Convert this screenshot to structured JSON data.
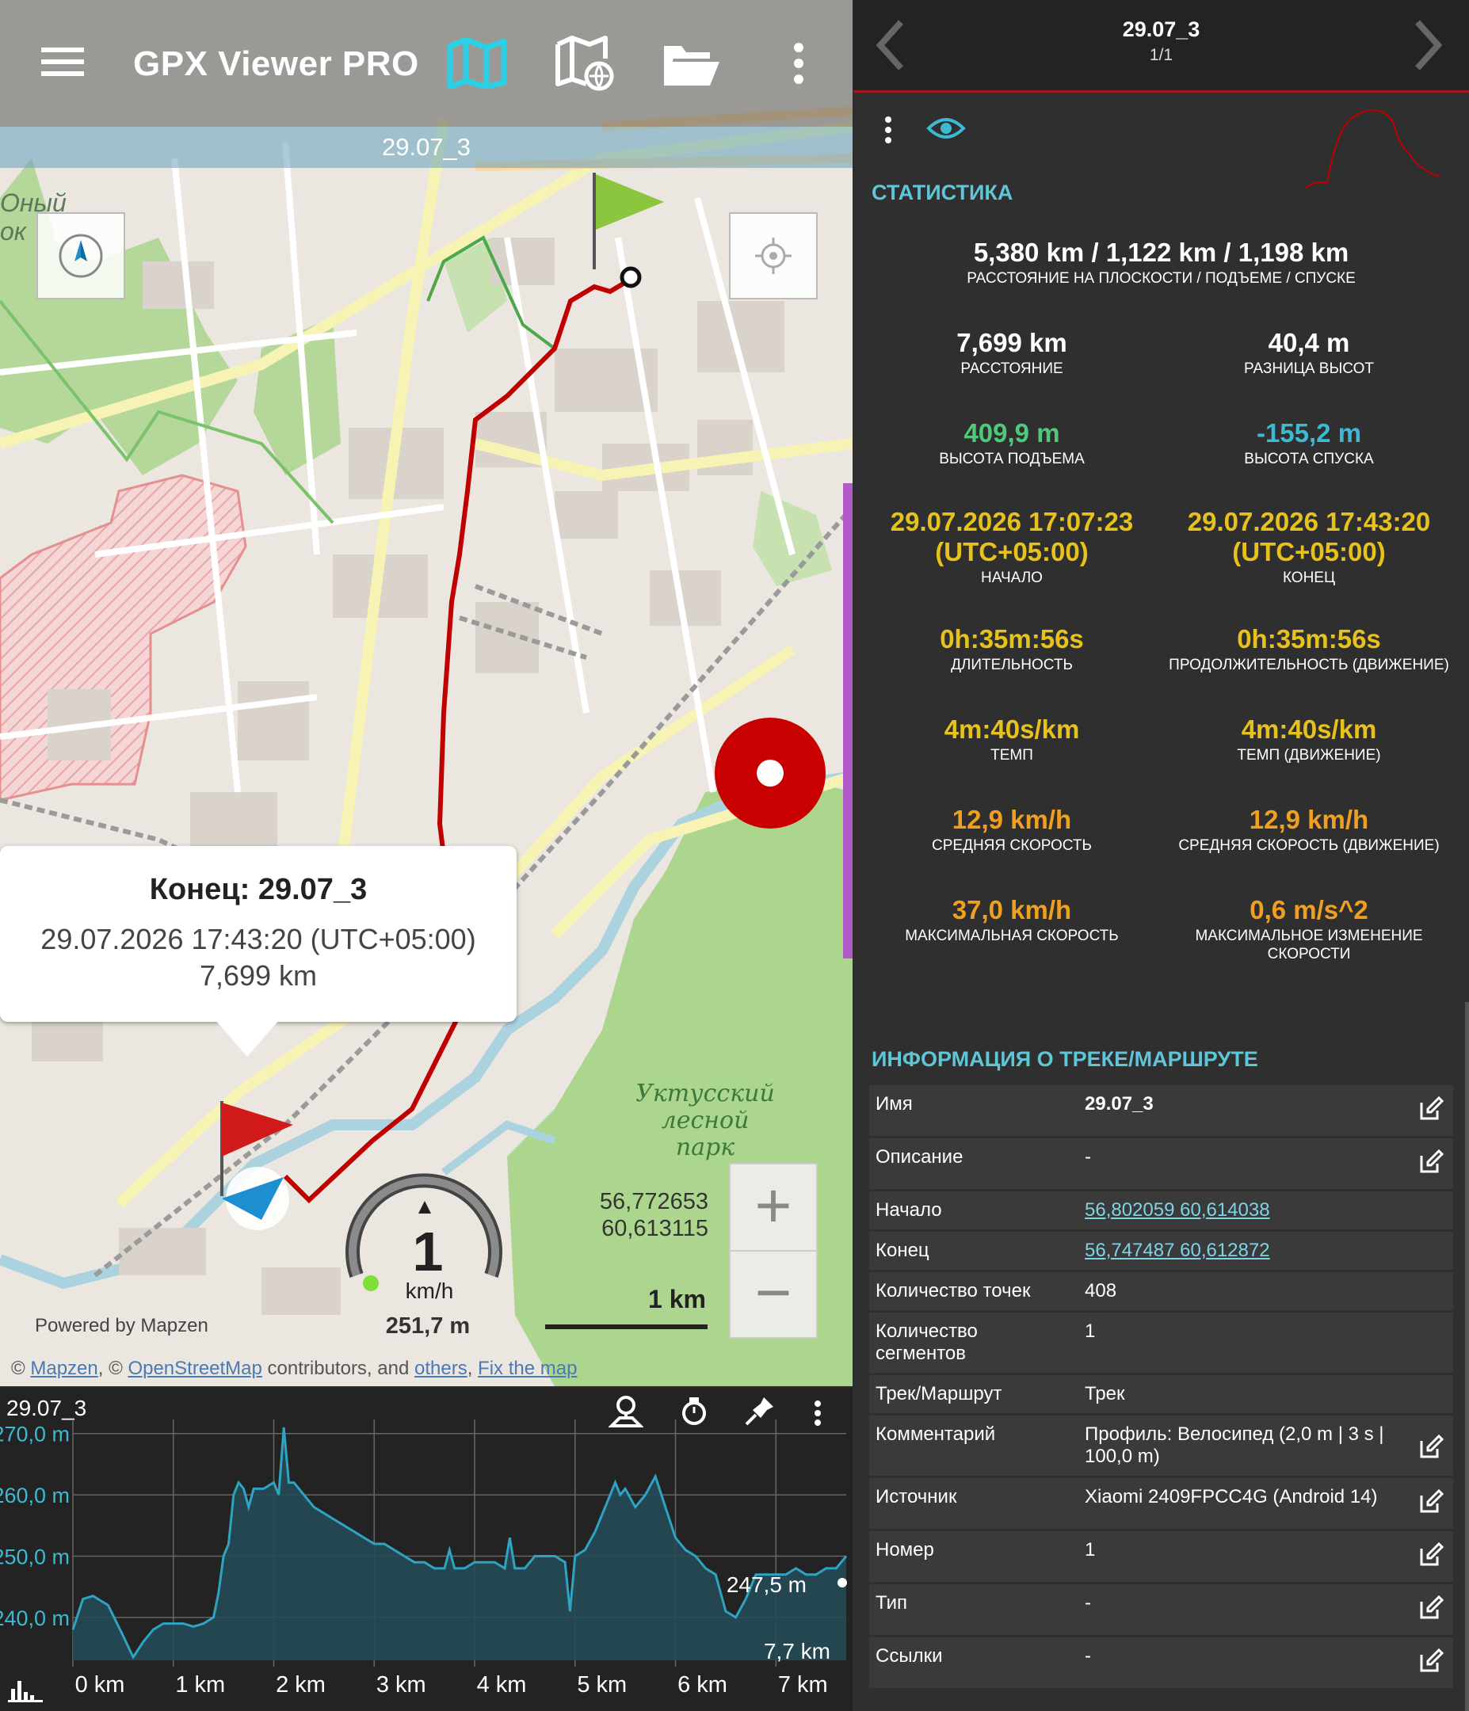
{
  "app": {
    "title": "GPX Viewer PRO"
  },
  "map": {
    "track_strip": "29.07_3",
    "popup": {
      "title": "Конец: 29.07_3",
      "time": "29.07.2026 17:43:20 (UTC+05:00)",
      "distance": "7,699 km"
    },
    "coords": {
      "lat": "56,772653",
      "lon": "60,613115"
    },
    "scale_label": "1 km",
    "speed": {
      "value": "1",
      "unit": "km/h",
      "distance": "251,7 m"
    },
    "park_label_1": "Уктусский",
    "park_label_2": "лесной парк",
    "district_fragment_1": "Оный",
    "district_fragment_2": "ок",
    "powered_by": "Powered by Mapzen",
    "attribution": {
      "prefix": "© ",
      "mapzen": "Mapzen",
      "sep": ", © ",
      "osm": "OpenStreetMap",
      "mid": " contributors, and ",
      "others": "others",
      "comma": ", ",
      "fix": "Fix the map"
    },
    "zoom_in": "+",
    "zoom_out": "−"
  },
  "elevation": {
    "title": "29.07_3",
    "current_value": "247,5 m",
    "current_distance": "7,7 km",
    "chart_data": {
      "type": "area",
      "xlabel": "",
      "ylabel": "",
      "x_ticks": [
        "0 km",
        "1 km",
        "2 km",
        "3 km",
        "4 km",
        "5 km",
        "6 km",
        "7 km"
      ],
      "y_ticks": [
        "270,0 m",
        "260,0 m",
        "250,0 m",
        "240,0 m"
      ],
      "ylim": [
        233,
        271
      ],
      "xlim": [
        0,
        7.7
      ],
      "x": [
        0,
        0.1,
        0.2,
        0.35,
        0.5,
        0.6,
        0.7,
        0.8,
        0.9,
        1.0,
        1.1,
        1.2,
        1.3,
        1.4,
        1.45,
        1.5,
        1.55,
        1.6,
        1.65,
        1.7,
        1.75,
        1.8,
        1.9,
        2.0,
        2.05,
        2.1,
        2.15,
        2.2,
        2.3,
        2.4,
        2.5,
        2.6,
        2.7,
        2.8,
        2.9,
        3.0,
        3.1,
        3.2,
        3.3,
        3.4,
        3.5,
        3.6,
        3.7,
        3.75,
        3.8,
        3.9,
        4.0,
        4.1,
        4.2,
        4.3,
        4.35,
        4.4,
        4.5,
        4.6,
        4.7,
        4.8,
        4.9,
        4.95,
        5.0,
        5.1,
        5.2,
        5.3,
        5.4,
        5.45,
        5.5,
        5.6,
        5.7,
        5.8,
        5.9,
        6.0,
        6.1,
        6.2,
        6.3,
        6.4,
        6.5,
        6.6,
        6.7,
        6.8,
        6.9,
        7.0,
        7.1,
        7.2,
        7.3,
        7.4,
        7.5,
        7.6,
        7.7
      ],
      "values": [
        238,
        243,
        243.5,
        242,
        237,
        233.5,
        236,
        238,
        239,
        239,
        239,
        238.5,
        239,
        240,
        244,
        250,
        252,
        260,
        262,
        261,
        258,
        261,
        261,
        262,
        260,
        271,
        262,
        262,
        260,
        258,
        257,
        256,
        255,
        254,
        253,
        252,
        252,
        251,
        250,
        249,
        249,
        248,
        248,
        251,
        248,
        248,
        249,
        249,
        249,
        248,
        253,
        248,
        248,
        250,
        250,
        250,
        249,
        241,
        250,
        251,
        254,
        258,
        262,
        260,
        261,
        258,
        260,
        263,
        258,
        253,
        251,
        250,
        248,
        247,
        241,
        240,
        243,
        247,
        247,
        247,
        247,
        248,
        247,
        247,
        248,
        248,
        250
      ]
    }
  },
  "right": {
    "title": "29.07_3",
    "subtitle": "1/1",
    "stats_header": "СТАТИСТИКА",
    "summary": {
      "value": "5,380 km / 1,122 km / 1,198 km",
      "label": "РАССТОЯНИЕ НА ПЛОСКОСТИ / ПОДЪЕМЕ / СПУСКЕ"
    },
    "stats": [
      {
        "value": "7,699 km",
        "label": "РАССТОЯНИЕ",
        "color": "#ffffff"
      },
      {
        "value": "40,4 m",
        "label": "РАЗНИЦА ВЫСОТ",
        "color": "#ffffff"
      },
      {
        "value": "409,9 m",
        "label": "ВЫСОТА ПОДЪЕМА",
        "color": "#4fc97a"
      },
      {
        "value": "-155,2 m",
        "label": "ВЫСОТА СПУСКА",
        "color": "#3bbad2"
      },
      {
        "value": "29.07.2026 17:07:23 (UTC+05:00)",
        "label": "НАЧАЛО",
        "color": "#e8c21c"
      },
      {
        "value": "29.07.2026 17:43:20 (UTC+05:00)",
        "label": "КОНЕЦ",
        "color": "#e8c21c"
      },
      {
        "value": "0h:35m:56s",
        "label": "ДЛИТЕЛЬНОСТЬ",
        "color": "#e8c21c"
      },
      {
        "value": "0h:35m:56s",
        "label": "ПРОДОЛЖИТЕЛЬНОСТЬ (ДВИЖЕНИЕ)",
        "color": "#e8c21c"
      },
      {
        "value": "4m:40s/km",
        "label": "ТЕМП",
        "color": "#e8c21c"
      },
      {
        "value": "4m:40s/km",
        "label": "ТЕМП (ДВИЖЕНИЕ)",
        "color": "#e8c21c"
      },
      {
        "value": "12,9 km/h",
        "label": "СРЕДНЯЯ СКОРОСТЬ",
        "color": "#f0a020"
      },
      {
        "value": "12,9 km/h",
        "label": "СРЕДНЯЯ СКОРОСТЬ (ДВИЖЕНИЕ)",
        "color": "#f0a020"
      },
      {
        "value": "37,0 km/h",
        "label": "МАКСИМАЛЬНАЯ СКОРОСТЬ",
        "color": "#f0a020"
      },
      {
        "value": "0,6 m/s^2",
        "label": "МАКСИМАЛЬНОЕ ИЗМЕНЕНИЕ СКОРОСТИ",
        "color": "#f0a020"
      }
    ],
    "stat_parts": {
      "start_date": "29.07.2026 17:07:23",
      "start_tz": "(UTC+05:00)",
      "end_date": "29.07.2026 17:43:20",
      "end_tz": "(UTC+05:00)",
      "max_change_label_1": "МАКСИМАЛЬНОЕ ИЗМЕНЕНИЕ",
      "max_change_label_2": "СКОРОСТИ"
    },
    "info_header": "ИНФОРМАЦИЯ О ТРЕКЕ/МАРШРУТЕ",
    "info": [
      {
        "key": "Имя",
        "value": "29.07_3",
        "editable": true,
        "bold": true
      },
      {
        "key": "Описание",
        "value": "-",
        "editable": true
      },
      {
        "key": "Начало",
        "value": "56,802059 60,614038",
        "link": true
      },
      {
        "key": "Конец",
        "value": "56,747487 60,612872",
        "link": true
      },
      {
        "key": "Количество точек",
        "value": "408"
      },
      {
        "key": "Количество сегментов",
        "value": "1"
      },
      {
        "key": "Трек/Маршрут",
        "value": "Трек"
      },
      {
        "key": "Комментарий",
        "value": "Профиль: Велосипед (2,0 m | 3 s | 100,0 m)",
        "editable": true
      },
      {
        "key": "Источник",
        "value": "Xiaomi 2409FPCC4G (Android 14)",
        "editable": true
      },
      {
        "key": "Номер",
        "value": "1",
        "editable": true
      },
      {
        "key": "Тип",
        "value": "-",
        "editable": true
      },
      {
        "key": "Ссылки",
        "value": "-",
        "editable": true
      }
    ],
    "accent": "#5fc6d8",
    "track_color": "#c00000"
  }
}
